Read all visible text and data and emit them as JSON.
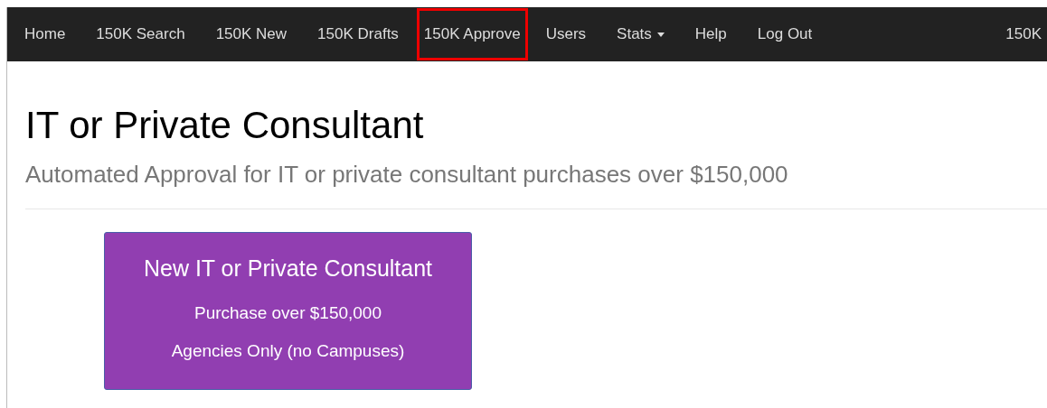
{
  "navbar": {
    "items": [
      {
        "label": "Home",
        "kind": "link",
        "highlighted": false
      },
      {
        "label": "150K Search",
        "kind": "link",
        "highlighted": false
      },
      {
        "label": "150K New",
        "kind": "link",
        "highlighted": false
      },
      {
        "label": "150K Drafts",
        "kind": "link",
        "highlighted": false
      },
      {
        "label": "150K Approve",
        "kind": "link",
        "highlighted": true
      },
      {
        "label": "Users",
        "kind": "link",
        "highlighted": false
      },
      {
        "label": "Stats",
        "kind": "dropdown",
        "highlighted": false
      },
      {
        "label": "Help",
        "kind": "link",
        "highlighted": false
      },
      {
        "label": "Log Out",
        "kind": "link",
        "highlighted": false
      }
    ],
    "right_text": "150K"
  },
  "page": {
    "title": "IT or Private Consultant",
    "subtitle": "Automated Approval for IT or private consultant purchases over $150,000"
  },
  "action_button": {
    "title": "New IT or Private Consultant",
    "lines": [
      "Purchase over $150,000",
      "Agencies Only (no Campuses)"
    ]
  }
}
